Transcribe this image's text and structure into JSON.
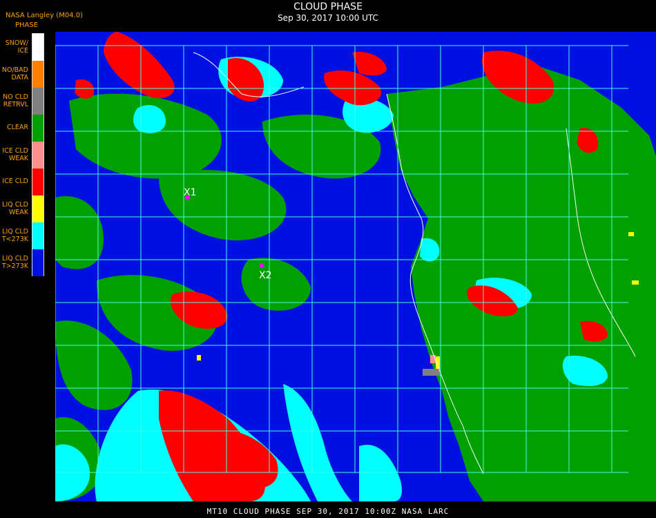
{
  "header": {
    "org": "NASA Langley (M04.0)",
    "product": "PHASE",
    "title": "CLOUD PHASE",
    "datetime": "Sep 30, 2017 10:00 UTC"
  },
  "legend": [
    {
      "label": "SNOW/\nICE",
      "color": "#ffffff"
    },
    {
      "label": "NO/BAD\nDATA",
      "color": "#ff8000"
    },
    {
      "label": "NO CLD\nRETRVL",
      "color": "#808080"
    },
    {
      "label": "CLEAR",
      "color": "#00a000"
    },
    {
      "label": "ICE CLD\nWEAK",
      "color": "#ff9090"
    },
    {
      "label": "ICE CLD",
      "color": "#ff0000"
    },
    {
      "label": "LIQ CLD\nWEAK",
      "color": "#ffff00"
    },
    {
      "label": "LIQ CLD\nT<273K",
      "color": "#00ffff"
    },
    {
      "label": "LIQ CLD\nT>273K",
      "color": "#0010e0"
    }
  ],
  "markers": [
    {
      "label": "X1"
    },
    {
      "label": "X2"
    }
  ],
  "grid_color": "#40ffe0",
  "footer": "MT10  CLOUD PHASE   SEP 30, 2017 10:00Z   NASA LARC"
}
